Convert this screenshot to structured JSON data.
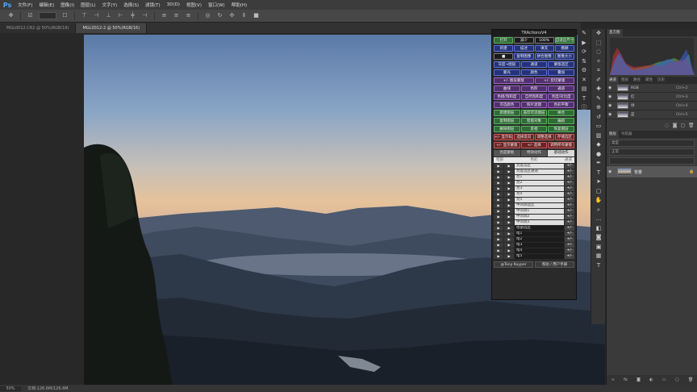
{
  "app": {
    "logo": "Ps"
  },
  "menu": [
    "文件(F)",
    "编辑(E)",
    "图像(I)",
    "图层(L)",
    "文字(Y)",
    "选择(S)",
    "滤镜(T)",
    "3D(D)",
    "视图(V)",
    "窗口(W)",
    "帮助(H)"
  ],
  "doc_tabs": [
    {
      "label": "MGL0012.CR2 @ 50%(RGB/16)",
      "active": false
    },
    {
      "label": "MGL0012-2 @ 50%(RGB/16)",
      "active": true
    }
  ],
  "status": {
    "zoom": "50%",
    "doc": "文档:126.6M/126.6M"
  },
  "tk": {
    "title": "TKActionsV4",
    "rows": [
      [
        {
          "l": "打开",
          "c": "green"
        },
        {
          "l": "减少",
          "c": "dark"
        },
        {
          "l": "100%",
          "c": "dark"
        },
        {
          "l": "自适应尺寸",
          "c": "green"
        }
      ],
      [
        {
          "l": "新建",
          "c": "blue"
        },
        {
          "l": "描述",
          "c": "blue"
        },
        {
          "l": "填充",
          "c": "blue"
        },
        {
          "l": "模糊",
          "c": "blue"
        }
      ],
      [
        {
          "l": "■",
          "c": "dark"
        },
        {
          "l": "复制图像",
          "c": "blue"
        },
        {
          "l": "拼合图像",
          "c": "blue"
        },
        {
          "l": "图像大小",
          "c": "blue"
        }
      ],
      [
        {
          "l": "灰度→图层",
          "c": "blue"
        },
        {
          "l": "通道",
          "c": "blue"
        },
        {
          "l": "蒙版选区",
          "c": "blue"
        }
      ],
      [
        {
          "l": "蒙光",
          "c": "blue"
        },
        {
          "l": "颜色",
          "c": "blue"
        },
        {
          "l": "叠加",
          "c": "blue"
        }
      ],
      [
        {
          "l": "+/- 图层蒙版",
          "c": "purple"
        },
        {
          "l": "+/- 剪切蒙版",
          "c": "purple"
        }
      ],
      [
        {
          "l": "曲线",
          "c": "purple"
        },
        {
          "l": "色阶",
          "c": "purple"
        },
        {
          "l": "通道",
          "c": "purple"
        }
      ],
      [
        {
          "l": "色相/饱和度",
          "c": "purple"
        },
        {
          "l": "自然饱和度",
          "c": "purple"
        },
        {
          "l": "亮度/对比度",
          "c": "purple"
        }
      ],
      [
        {
          "l": "可选颜色",
          "c": "purple"
        },
        {
          "l": "照片滤镜",
          "c": "purple"
        },
        {
          "l": "色彩平衡",
          "c": "purple"
        }
      ],
      [
        {
          "l": "新建图层",
          "c": "green"
        },
        {
          "l": "盖印可见图层",
          "c": "green"
        },
        {
          "l": "拼合",
          "c": "green"
        }
      ],
      [
        {
          "l": "复制图层",
          "c": "green"
        },
        {
          "l": "智能对象",
          "c": "green"
        },
        {
          "l": "编组",
          "c": "green"
        }
      ],
      [
        {
          "l": "删除图层",
          "c": "green"
        },
        {
          "l": "反相",
          "c": "green"
        },
        {
          "l": "恢复图层",
          "c": "green"
        }
      ],
      [
        {
          "l": "+/- 显示标线",
          "c": "red"
        },
        {
          "l": "选择反向",
          "c": "red"
        },
        {
          "l": "调整选择",
          "c": "red"
        },
        {
          "l": "存储选区",
          "c": "red"
        }
      ],
      [
        {
          "l": "+/- 显示蒙版",
          "c": "red"
        },
        {
          "l": "+/- 选择",
          "c": "red"
        },
        {
          "l": "调用所有蒙版",
          "c": "red"
        }
      ]
    ],
    "tabs": [
      {
        "l": "亮度蒙板",
        "on": false
      },
      {
        "l": "特效动作",
        "on": false
      },
      {
        "l": "基础动作",
        "on": true
      }
    ],
    "act_header": {
      "left": "暗部",
      "mid": "色彩",
      "right": "通道"
    },
    "actions": [
      {
        "n": "亮度选区",
        "t": "light"
      },
      {
        "n": "亮度选区通道",
        "t": "light"
      },
      {
        "n": "亮1",
        "t": "light"
      },
      {
        "n": "亮2",
        "t": "light"
      },
      {
        "n": "亮3",
        "t": "light"
      },
      {
        "n": "亮4",
        "t": "light"
      },
      {
        "n": "亮5",
        "t": "light"
      },
      {
        "n": "中间调选区",
        "t": "light"
      },
      {
        "n": "中间调1",
        "t": "light"
      },
      {
        "n": "中间调2",
        "t": "light"
      },
      {
        "n": "中间调3",
        "t": "light"
      },
      {
        "n": "暗部选区",
        "t": "dark"
      },
      {
        "n": "暗1",
        "t": "dark"
      },
      {
        "n": "暗2",
        "t": "dark"
      },
      {
        "n": "暗3",
        "t": "dark"
      },
      {
        "n": "暗4",
        "t": "dark"
      },
      {
        "n": "暗5",
        "t": "dark"
      }
    ],
    "exp_label": "+/-",
    "play_label": "▶",
    "footer": [
      "@Tony Kuyper",
      "帮助 / 用户手册"
    ]
  },
  "panels": {
    "hist_tab": "直方图",
    "channel_tabs": [
      "通道",
      "图层",
      "路径",
      "属性",
      "历史"
    ],
    "channels": [
      {
        "name": "RGB",
        "sc": "Ctrl+2"
      },
      {
        "name": "红",
        "sc": "Ctrl+3"
      },
      {
        "name": "绿",
        "sc": "Ctrl+4"
      },
      {
        "name": "蓝",
        "sc": "Ctrl+5"
      }
    ],
    "layers_tabs": [
      "图层",
      "导航器"
    ],
    "layers_filter": "类型",
    "blend_mode": "正常",
    "bg_layer": "背景"
  }
}
